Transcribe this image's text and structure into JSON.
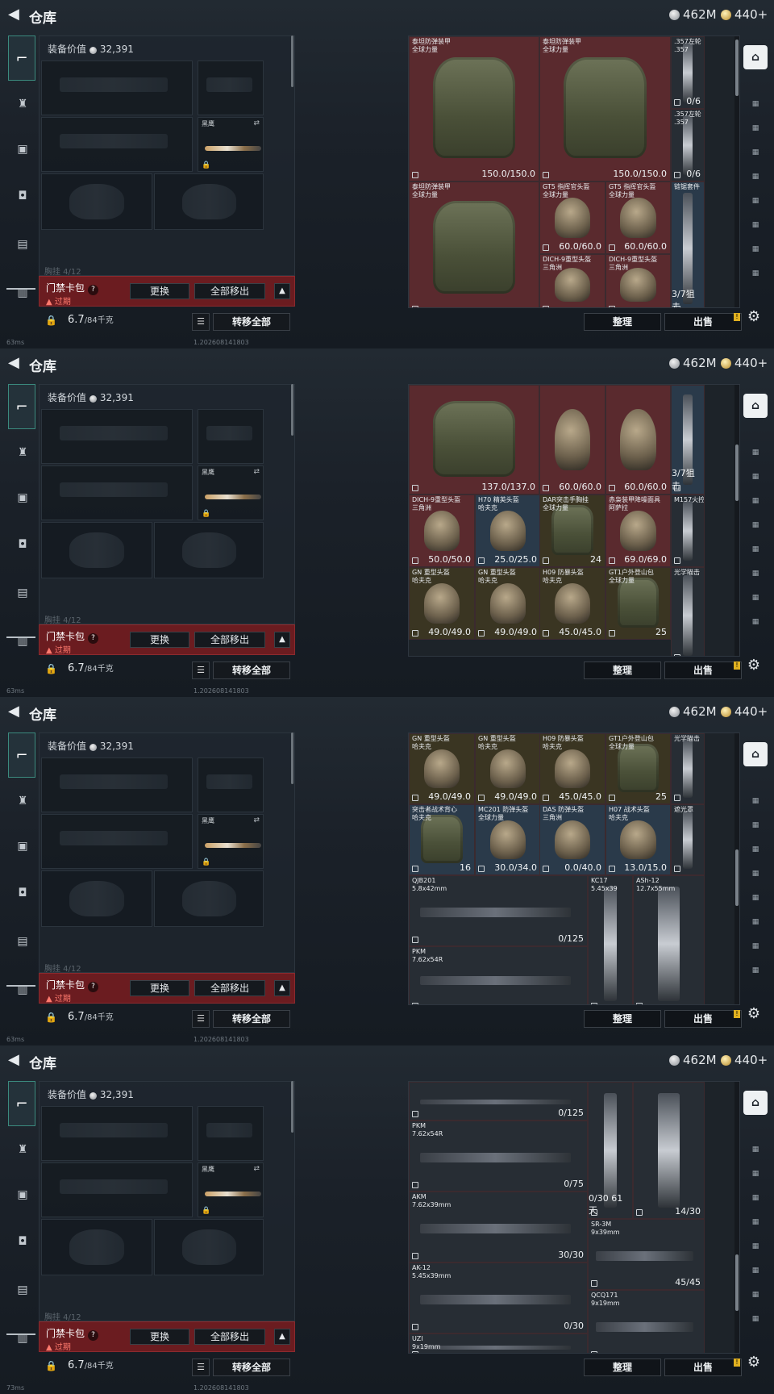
{
  "header": {
    "back_icon": "back-arrow-icon",
    "title": "仓库",
    "silver": "462M",
    "gold": "440+"
  },
  "left_nav": [
    "weapon-icon",
    "armor-vest-icon",
    "chest-rig-icon",
    "backpack-icon",
    "pouch-icon",
    "case-icon"
  ],
  "equipment": {
    "value_label": "装备价值",
    "value": "32,391",
    "knife_name": "黑鹰",
    "faded_text": "胸挂 4/12",
    "keycard": {
      "name": "门禁卡包",
      "help": "?",
      "expired": "过期"
    },
    "buttons": {
      "replace": "更换",
      "move_out_all": "全部移出"
    }
  },
  "weight": {
    "current": "6.7",
    "max": "/84千克"
  },
  "actions": {
    "transfer_all": "转移全部",
    "sort": "整理",
    "sell": "出售"
  },
  "status_bar": {
    "ping": "63ms",
    "build": "1.202608141803"
  },
  "status_bar_last": {
    "ping": "73ms"
  },
  "frames": [
    {
      "cells": [
        {
          "name": "泰坦防弹装甲\n全球力量",
          "value": "150.0/150.0",
          "color": "red",
          "art": "vest"
        },
        {
          "name": "泰坦防弹装甲\n全球力量",
          "value": "150.0/150.0",
          "color": "red",
          "art": "vest"
        },
        {
          "name": ".357左轮\n.357",
          "value": "0/6",
          "color": "gray",
          "art": "vgun"
        },
        {
          "name": ".357左轮\n.357",
          "value": "0/6",
          "color": "gray",
          "art": "vgun"
        },
        {
          "name": "泰坦防弹装甲\n全球力量",
          "value": "",
          "color": "red",
          "art": "vest"
        },
        {
          "name": "GT5 指挥官头盔\n全球力量",
          "value": "60.0/60.0",
          "color": "red",
          "art": "helmet"
        },
        {
          "name": "GT5 指挥官头盔\n全球力量",
          "value": "60.0/60.0",
          "color": "red",
          "art": "helmet"
        },
        {
          "name": "链锯套件",
          "value": "3/7狙击",
          "color": "blue",
          "art": "vgun"
        },
        {
          "name": "DICH-9重型头盔\n三角洲",
          "value": "",
          "color": "red",
          "art": "helmet"
        },
        {
          "name": "DICH-9重型头盔\n三角洲",
          "value": "",
          "color": "red",
          "art": "helmet"
        }
      ]
    },
    {
      "cells": [
        {
          "name": "",
          "value": "137.0/137.0",
          "color": "red",
          "art": "vest"
        },
        {
          "name": "",
          "value": "60.0/60.0",
          "color": "red",
          "art": "helmet"
        },
        {
          "name": "",
          "value": "60.0/60.0",
          "color": "red",
          "art": "helmet"
        },
        {
          "name": "",
          "value": "3/7狙击",
          "color": "blue",
          "art": "vgun"
        },
        {
          "name": "DICH-9重型头盔\n三角洲",
          "value": "50.0/50.0",
          "color": "red",
          "art": "helmet"
        },
        {
          "name": "DICH-9重型头盔\n三角洲",
          "value": "50.0/50.0",
          "color": "red",
          "art": "helmet"
        },
        {
          "name": "DICH-9重型头盔\n三角洲",
          "value": "50.0/50.0",
          "color": "red",
          "art": "helmet"
        },
        {
          "name": "H70 精英头盔\n哈夫克",
          "value": "25.0/25.0",
          "color": "blue",
          "art": "helmet"
        },
        {
          "name": "DAR突击手胸挂\n全球力量",
          "value": "24",
          "color": "green",
          "art": "vest"
        },
        {
          "name": "赤枭装甲降噪面具\n阿萨拉",
          "value": "69.0/69.0",
          "color": "red",
          "art": "helmet"
        },
        {
          "name": "M157火控",
          "value": "",
          "color": "gray",
          "art": "vgun"
        },
        {
          "name": "GN 重型头盔\n哈夫克",
          "value": "49.0/49.0",
          "color": "green",
          "art": "helmet"
        },
        {
          "name": "GN 重型头盔\n哈夫克",
          "value": "49.0/49.0",
          "color": "green",
          "art": "helmet"
        },
        {
          "name": "H09 防暴头盔\n哈夫克",
          "value": "45.0/45.0",
          "color": "green",
          "art": "helmet"
        },
        {
          "name": "GT1户外登山包\n全球力量",
          "value": "25",
          "color": "green",
          "art": "vest"
        },
        {
          "name": "光学瞄击",
          "value": "",
          "color": "gray",
          "art": "vgun"
        }
      ]
    },
    {
      "cells": [
        {
          "name": "GN 重型头盔\n哈夫克",
          "value": "49.0/49.0",
          "color": "green",
          "art": "helmet"
        },
        {
          "name": "GN 重型头盔\n哈夫克",
          "value": "49.0/49.0",
          "color": "green",
          "art": "helmet"
        },
        {
          "name": "H09 防暴头盔\n哈夫克",
          "value": "45.0/45.0",
          "color": "green",
          "art": "helmet"
        },
        {
          "name": "GT1户外登山包\n全球力量",
          "value": "25",
          "color": "green",
          "art": "vest"
        },
        {
          "name": "光学瞄击",
          "value": "",
          "color": "gray",
          "art": "vgun"
        },
        {
          "name": "突击者战术背心\n哈夫克",
          "value": "16",
          "color": "blue",
          "art": "vest"
        },
        {
          "name": "MC201 防弹头盔\n全球力量",
          "value": "30.0/34.0",
          "color": "blue",
          "art": "helmet"
        },
        {
          "name": "DAS 防弹头盔\n三角洲",
          "value": "0.0/40.0",
          "color": "blue",
          "art": "helmet"
        },
        {
          "name": "H07 战术头盔\n哈夫克",
          "value": "13.0/15.0",
          "color": "blue",
          "art": "helmet"
        },
        {
          "name": "遮光罩",
          "value": "",
          "color": "gray",
          "art": "vgun"
        },
        {
          "name": "QJB201\n5.8x42mm",
          "value": "0/125",
          "color": "gray",
          "art": "gun"
        },
        {
          "name": "KC17\n5.45x39",
          "value": "",
          "color": "gray",
          "art": "vgun"
        },
        {
          "name": "ASh-12\n12.7x55mm",
          "value": "",
          "color": "gray",
          "art": "vgun"
        },
        {
          "name": "PKM\n7.62x54R",
          "value": "",
          "color": "gray",
          "art": "gun"
        }
      ]
    },
    {
      "cells": [
        {
          "name": "",
          "value": "0/125",
          "color": "gray",
          "art": "gun"
        },
        {
          "name": "",
          "value": "0/30 61天",
          "color": "gray",
          "art": "vgun"
        },
        {
          "name": "",
          "value": "14/30",
          "color": "gray",
          "art": "vgun"
        },
        {
          "name": "PKM\n7.62x54R",
          "value": "0/75",
          "color": "gray",
          "art": "gun"
        },
        {
          "name": "AKM\n7.62x39mm",
          "value": "30/30",
          "color": "gray",
          "art": "gun"
        },
        {
          "name": "SR-3M\n9x39mm",
          "value": "45/45",
          "color": "gray",
          "art": "gun"
        },
        {
          "name": "AK-12\n5.45x39mm",
          "value": "0/30",
          "color": "gray",
          "art": "gun"
        },
        {
          "name": "QCQ171\n9x19mm",
          "value": "",
          "color": "gray",
          "art": "gun"
        },
        {
          "name": "UZI\n9x19mm",
          "value": "",
          "color": "gray",
          "art": "gun"
        }
      ]
    }
  ]
}
